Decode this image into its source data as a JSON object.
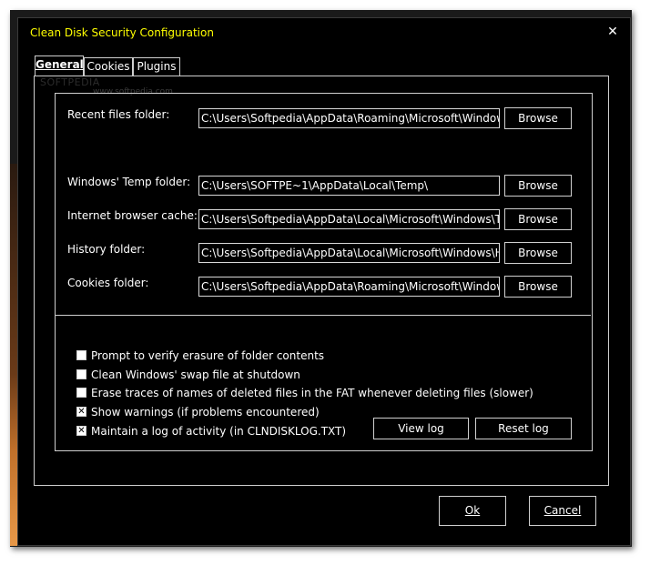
{
  "window": {
    "title": "Clean Disk Security Configuration",
    "close_glyph": "✕"
  },
  "tabs": [
    {
      "label": "General",
      "active": true
    },
    {
      "label": "Cookies",
      "active": false
    },
    {
      "label": "Plugins",
      "active": false
    }
  ],
  "watermark": {
    "text": "SOFTPEDIA",
    "url": "www.softpedia.com"
  },
  "folders": [
    {
      "label": "Recent files folder:",
      "value": "C:\\Users\\Softpedia\\AppData\\Roaming\\Microsoft\\Windows\\Recent",
      "button": "Browse"
    },
    {
      "label": "Windows' Temp folder:",
      "value": "C:\\Users\\SOFTPE~1\\AppData\\Local\\Temp\\",
      "button": "Browse"
    },
    {
      "label": "Internet browser cache:",
      "value": "C:\\Users\\Softpedia\\AppData\\Local\\Microsoft\\Windows\\Temporary Internet Files",
      "button": "Browse"
    },
    {
      "label": "History folder:",
      "value": "C:\\Users\\Softpedia\\AppData\\Local\\Microsoft\\Windows\\History",
      "button": "Browse"
    },
    {
      "label": "Cookies folder:",
      "value": "C:\\Users\\Softpedia\\AppData\\Roaming\\Microsoft\\Windows\\Cookies",
      "button": "Browse"
    }
  ],
  "options": [
    {
      "label": "Prompt to verify erasure of folder contents",
      "checked": false
    },
    {
      "label": "Clean Windows' swap file at shutdown",
      "checked": false
    },
    {
      "label": "Erase traces of names of deleted files in the FAT whenever deleting files (slower)",
      "checked": false
    },
    {
      "label": "Show warnings (if problems encountered)",
      "checked": true
    },
    {
      "label": "Maintain a log of activity (in CLNDISKLOG.TXT)",
      "checked": true
    }
  ],
  "log_buttons": {
    "view": "View log",
    "reset": "Reset log"
  },
  "footer": {
    "ok": "Ok",
    "cancel": "Cancel"
  },
  "colors": {
    "title": "#ffff00",
    "background": "#000000",
    "text": "#ffffff"
  }
}
